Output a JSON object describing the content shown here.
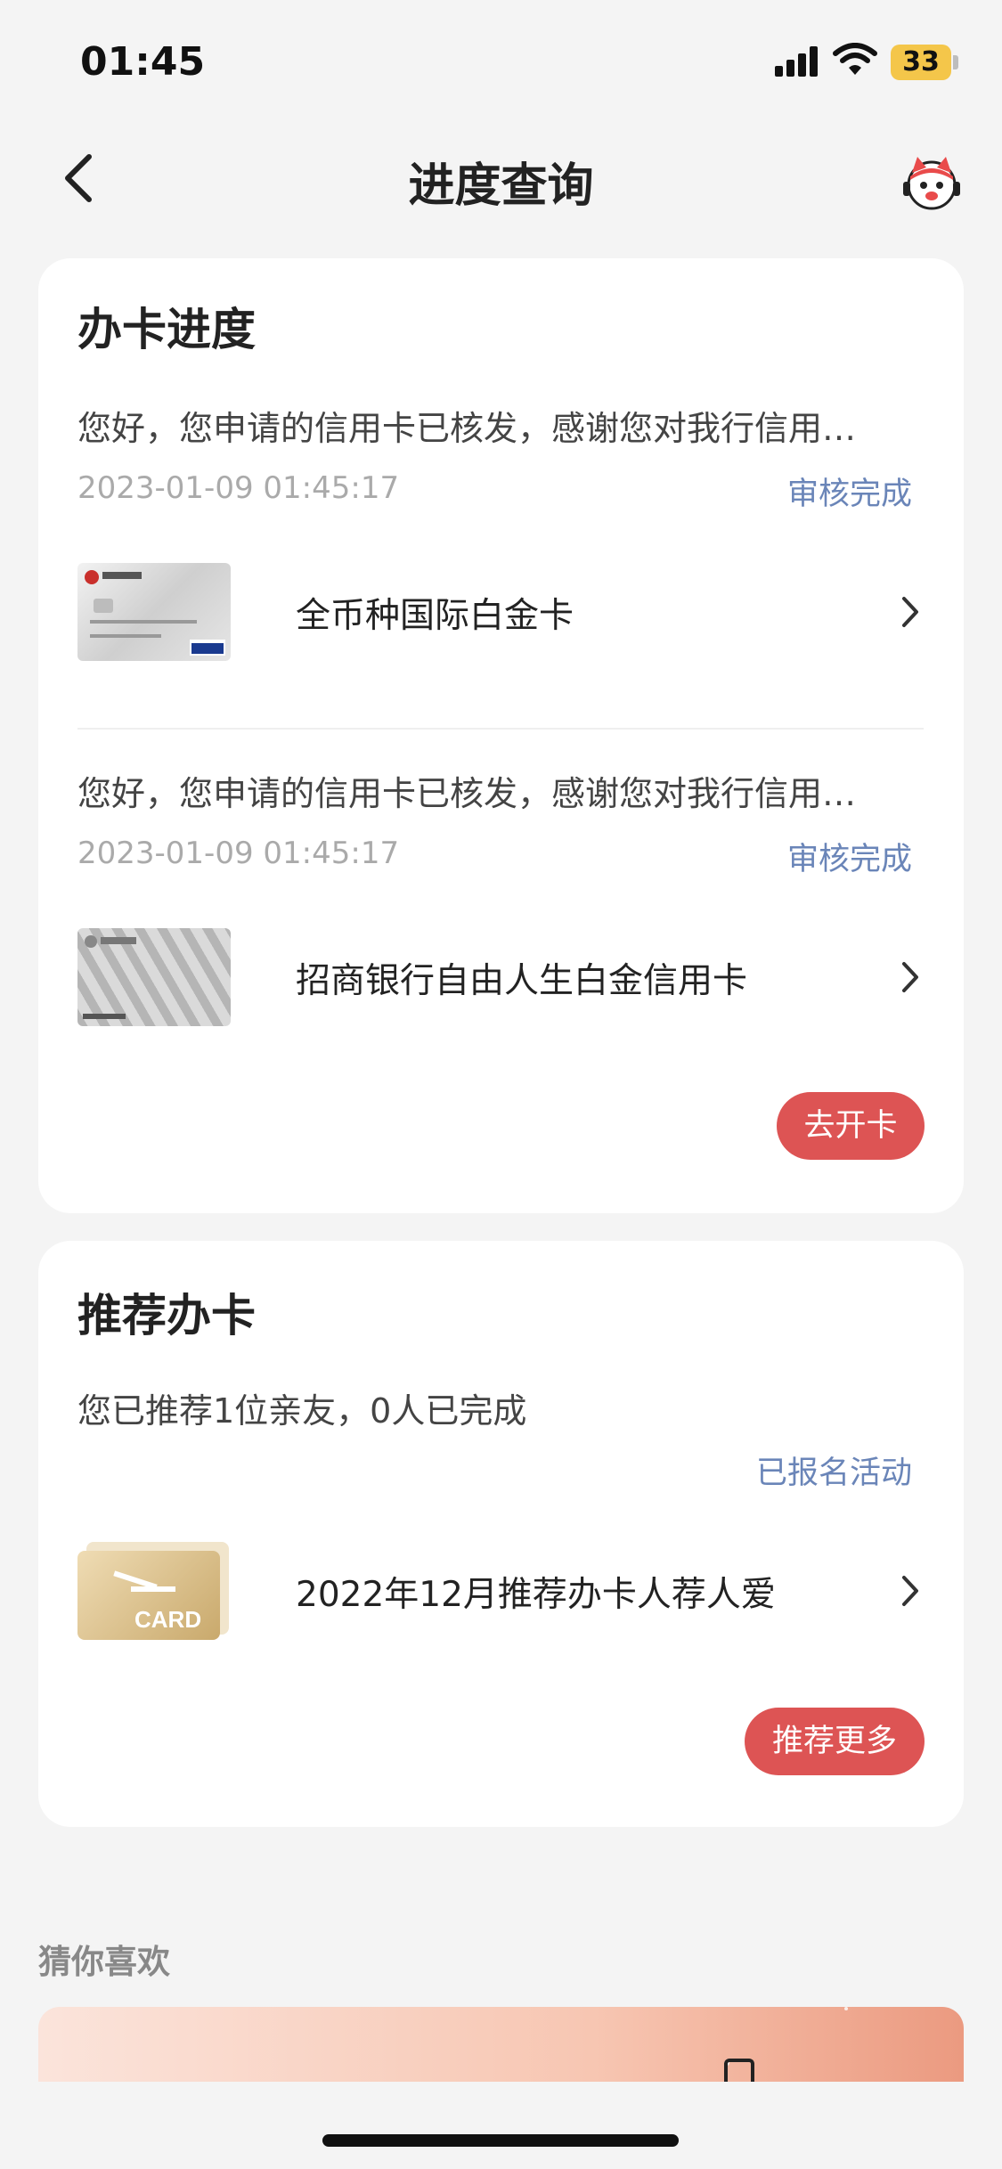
{
  "status_bar": {
    "time": "01:45",
    "battery": "33",
    "icons": [
      "signal-icon",
      "wifi-icon",
      "battery-icon"
    ]
  },
  "nav": {
    "back_icon": "chevron-left-icon",
    "title": "进度查询",
    "service_icon": "mascot-service-icon"
  },
  "progress": {
    "title": "办卡进度",
    "applications": [
      {
        "message": "您好，您申请的信用卡已核发，感谢您对我行信用…",
        "timestamp": "2023-01-09 01:45:17",
        "status": "审核完成",
        "card_name": "全币种国际白金卡"
      },
      {
        "message": "您好，您申请的信用卡已核发，感谢您对我行信用…",
        "timestamp": "2023-01-09 01:45:17",
        "status": "审核完成",
        "card_name": "招商银行自由人生白金信用卡"
      }
    ],
    "action_label": "去开卡"
  },
  "refer": {
    "title": "推荐办卡",
    "summary": "您已推荐1位亲友，0人已完成",
    "status": "已报名活动",
    "activity_name": "2022年12月推荐办卡人荐人爱",
    "thumb_label": "CARD",
    "action_label": "推荐更多"
  },
  "guess": {
    "title": "猜你喜欢"
  },
  "colors": {
    "accent_red": "#dd5454",
    "link_blue": "#6a85b8",
    "background": "#f4f4f4"
  }
}
